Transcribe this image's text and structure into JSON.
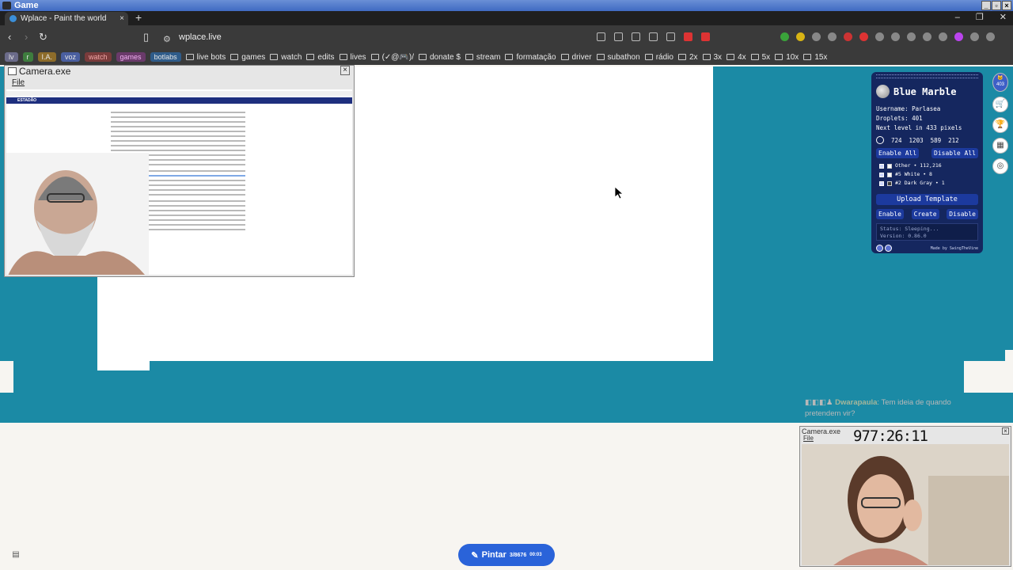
{
  "os": {
    "title": "Game"
  },
  "browser": {
    "tab_title": "Wplace - Paint the world",
    "new_tab": "+",
    "url": "wplace.live",
    "bookmarks": [
      {
        "label": "lv",
        "chip": "c1"
      },
      {
        "label": "r",
        "chip": "c2"
      },
      {
        "label": "I.A.",
        "chip": "c3"
      },
      {
        "label": "voz",
        "chip": "c4"
      },
      {
        "label": "watch",
        "chip": "c5"
      },
      {
        "label": "games",
        "chip": "c6"
      },
      {
        "label": "botlabs",
        "chip": "c7"
      },
      {
        "label": "live bots",
        "icon": true
      },
      {
        "label": "games",
        "icon": true
      },
      {
        "label": "watch",
        "icon": true
      },
      {
        "label": "edits",
        "icon": true
      },
      {
        "label": "lives",
        "icon": true
      },
      {
        "label": "(✓@🎮)/",
        "icon": true
      },
      {
        "label": "donate $",
        "icon": true
      },
      {
        "label": "stream",
        "icon": true
      },
      {
        "label": "formatação",
        "icon": true
      },
      {
        "label": "driver",
        "icon": true
      },
      {
        "label": "subathon",
        "icon": true
      },
      {
        "label": "rádio",
        "icon": true
      },
      {
        "label": "2x",
        "icon": true
      },
      {
        "label": "3x",
        "icon": true
      },
      {
        "label": "4x",
        "icon": true
      },
      {
        "label": "5x",
        "icon": true
      },
      {
        "label": "10x",
        "icon": true
      },
      {
        "label": "15x",
        "icon": true
      }
    ]
  },
  "camera1": {
    "title": "Camera.exe",
    "menu": "File",
    "site": "ESTADÃO"
  },
  "camera2": {
    "title": "Camera.exe",
    "menu": "File",
    "timer": "977:26:11"
  },
  "blue_marble": {
    "name": "Blue Marble",
    "username": "Username: Parlasea",
    "droplets": "Droplets: 401",
    "next_level": "Next level in 433 pixels",
    "coords": [
      "724",
      "1203",
      "589",
      "212"
    ],
    "enable_all": "Enable All",
    "disable_all": "Disable All",
    "colors": [
      {
        "label": "Other • 112,216",
        "swatch": "#ffffff"
      },
      {
        "label": "#5 White • 8",
        "swatch": "#ffffff"
      },
      {
        "label": "#2 Dark Gray • 1",
        "swatch": "#3c3c3c"
      }
    ],
    "upload": "Upload Template",
    "enable": "Enable",
    "create": "Create",
    "disable": "Disable",
    "status": "Status: Sleeping...",
    "version": "Version: 0.86.0",
    "made_by": "Made by SwingTheVine"
  },
  "side": {
    "badge": "403"
  },
  "chat": {
    "user": "Dwarapaula",
    "message": ": Tem ideia de quando pretendem vir?"
  },
  "paint": {
    "label": "Pintar",
    "count": "3/8676",
    "time": "00:03"
  },
  "colors": {
    "ocean": "#1b8aa5",
    "paint_button": "#2a63d9",
    "panel": "#15275f"
  }
}
